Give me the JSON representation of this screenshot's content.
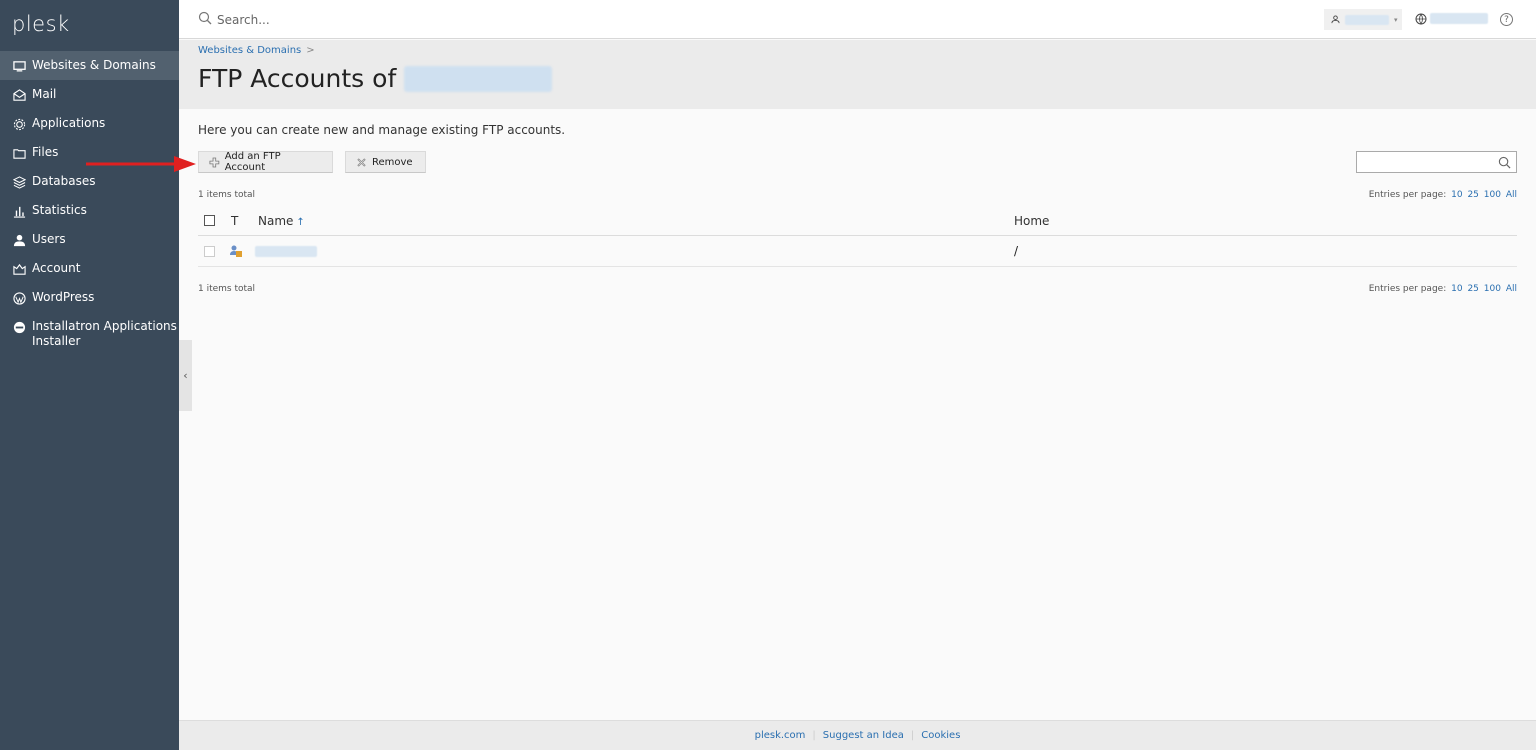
{
  "app": {
    "logo": "plesk"
  },
  "sidebar": {
    "items": [
      {
        "label": "Websites & Domains",
        "icon": "monitor-icon",
        "active": true
      },
      {
        "label": "Mail",
        "icon": "mail-icon"
      },
      {
        "label": "Applications",
        "icon": "gear-icon"
      },
      {
        "label": "Files",
        "icon": "folder-icon"
      },
      {
        "label": "Databases",
        "icon": "layers-icon"
      },
      {
        "label": "Statistics",
        "icon": "bar-chart-icon"
      },
      {
        "label": "Users",
        "icon": "user-icon"
      },
      {
        "label": "Account",
        "icon": "account-icon"
      },
      {
        "label": "WordPress",
        "icon": "wordpress-icon"
      },
      {
        "label": "Installatron Applications Installer",
        "icon": "installatron-icon"
      }
    ],
    "collapse_glyph": "‹"
  },
  "topbar": {
    "search_placeholder": "Search...",
    "help_glyph": "?"
  },
  "header": {
    "breadcrumb": "Websites & Domains",
    "breadcrumb_sep": ">",
    "title": "FTP Accounts of"
  },
  "content": {
    "hint": "Here you can create new and manage existing FTP accounts.",
    "add_button": "Add an FTP Account",
    "remove_button": "Remove",
    "items_total": "1 items total",
    "entries_label": "Entries per page:",
    "entries_options": [
      "10",
      "25",
      "100",
      "All"
    ]
  },
  "table": {
    "columns": {
      "type": "T",
      "name": "Name",
      "home": "Home"
    },
    "sort_arrow": "↑",
    "rows": [
      {
        "home": "/"
      }
    ]
  },
  "footer": {
    "links": [
      "plesk.com",
      "Suggest an Idea",
      "Cookies"
    ],
    "separator": "|"
  },
  "colors": {
    "sidebar_bg": "#3a4a5a",
    "sidebar_active": "#52616f",
    "link": "#2a6fb0",
    "arrow": "#e02020"
  }
}
